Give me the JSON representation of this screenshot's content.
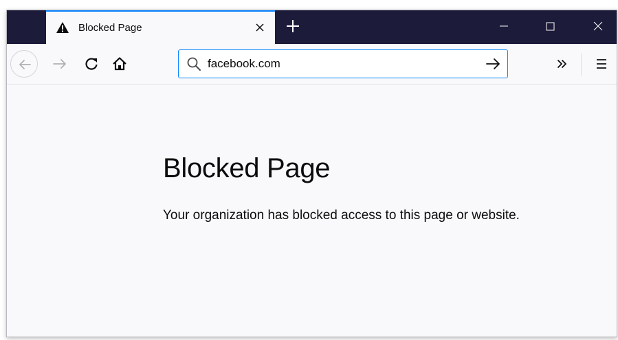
{
  "browser": {
    "tab": {
      "title": "Blocked Page",
      "icon": "warning-icon"
    },
    "window_controls": [
      "minimize-icon",
      "maximize-icon",
      "close-icon"
    ],
    "toolbar": {
      "back_icon": "back-arrow-icon",
      "forward_icon": "forward-arrow-icon",
      "reload_icon": "reload-icon",
      "home_icon": "home-icon",
      "overflow_icon": "chevron-double-right-icon",
      "menu_icon": "hamburger-menu-icon"
    },
    "urlbar": {
      "value": "facebook.com",
      "search_icon": "search-icon",
      "go_icon": "go-arrow-icon"
    }
  },
  "page": {
    "title": "Blocked Page",
    "message": "Your organization has blocked access to this page or website."
  },
  "colors": {
    "titlebar_bg": "#1c1b3a",
    "accent": "#0a84ff",
    "content_bg": "#f9f9fb"
  }
}
